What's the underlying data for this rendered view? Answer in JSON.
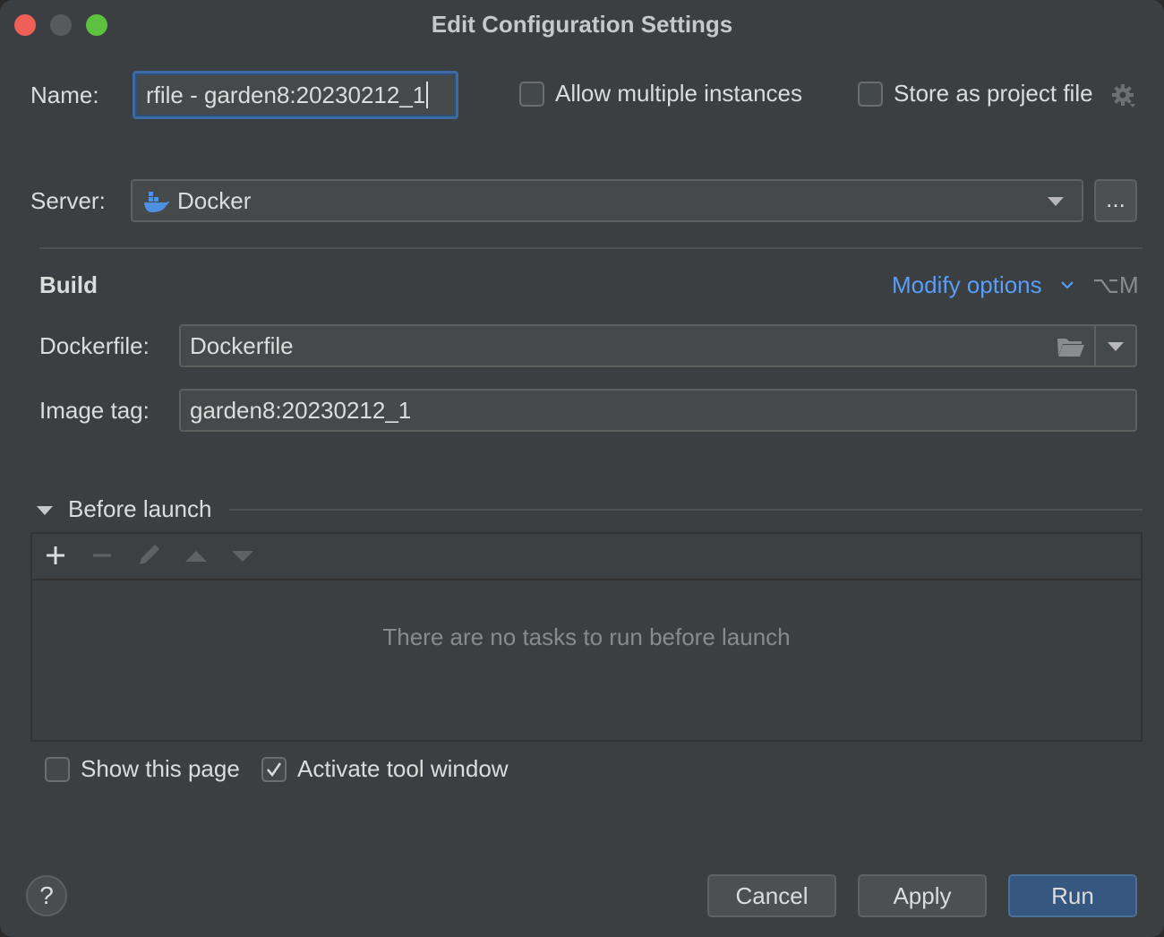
{
  "window": {
    "title": "Edit Configuration Settings"
  },
  "name": {
    "label": "Name:",
    "value": "rfile - garden8:20230212_1"
  },
  "options": {
    "allow_multiple": {
      "label": "Allow multiple instances",
      "checked": false
    },
    "store_project": {
      "label": "Store as project file",
      "checked": false
    }
  },
  "server": {
    "label": "Server:",
    "value": "Docker",
    "more_button": "..."
  },
  "build": {
    "title": "Build",
    "modify_options": "Modify options",
    "modify_shortcut": "⌥M",
    "dockerfile_label": "Dockerfile:",
    "dockerfile_value": "Dockerfile",
    "image_tag_label": "Image tag:",
    "image_tag_value": "garden8:20230212_1"
  },
  "before_launch": {
    "title": "Before launch",
    "empty_text": "There are no tasks to run before launch"
  },
  "footer_options": {
    "show_page": {
      "label": "Show this page",
      "checked": false
    },
    "activate_tool_window": {
      "label": "Activate tool window",
      "checked": true
    }
  },
  "buttons": {
    "help": "?",
    "cancel": "Cancel",
    "apply": "Apply",
    "run": "Run"
  },
  "colors": {
    "background": "#3c3f41",
    "accent_link": "#589df6",
    "primary_button": "#365880",
    "close": "#ee5f57",
    "maximize": "#5fc23f"
  }
}
